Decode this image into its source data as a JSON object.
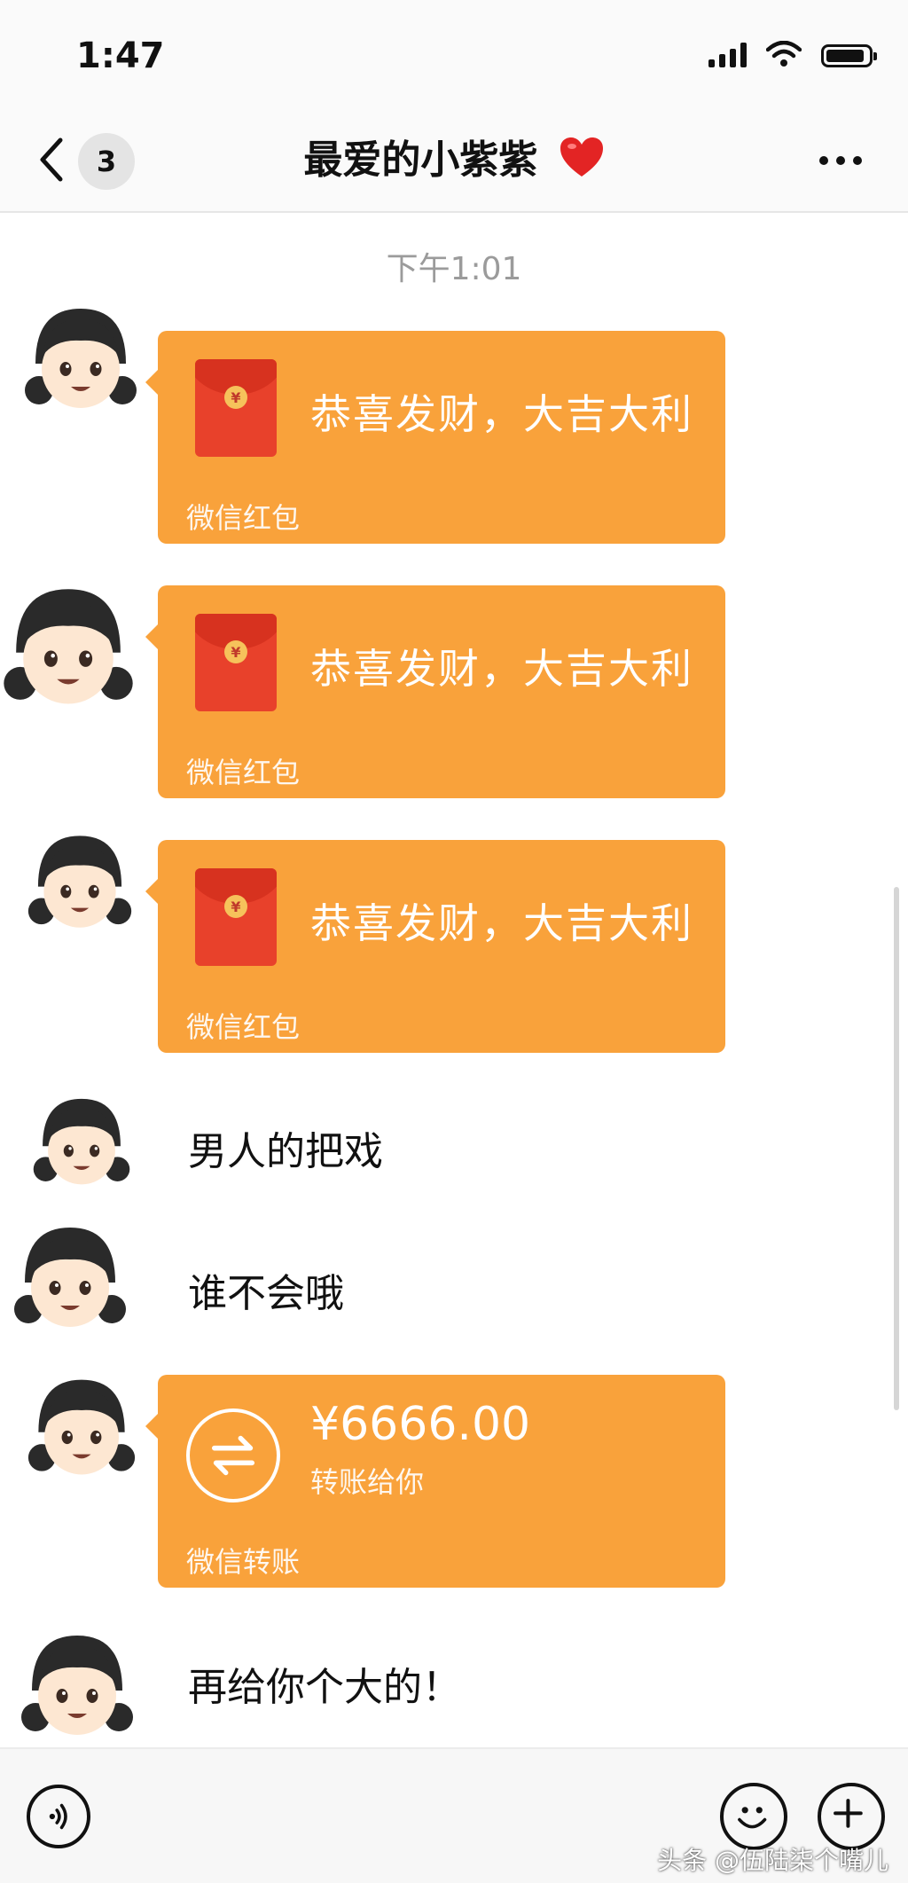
{
  "status_bar": {
    "time": "1:47",
    "icons": [
      "signal-icon",
      "wifi-icon",
      "battery-icon"
    ]
  },
  "header": {
    "back_icon": "chevron-left-icon",
    "unread_count": "3",
    "title": "最爱的小紫紫",
    "title_emoji": "red-heart-icon",
    "more_icon": "more-dots-icon"
  },
  "chat": {
    "timestamp": "下午1:01",
    "red_packets": [
      {
        "title": "恭喜发财，大吉大利",
        "footer": "微信红包"
      },
      {
        "title": "恭喜发财，大吉大利",
        "footer": "微信红包"
      },
      {
        "title": "恭喜发财，大吉大利",
        "footer": "微信红包"
      }
    ],
    "text_messages": [
      {
        "text": "男人的把戏"
      },
      {
        "text": "谁不会哦"
      },
      {
        "text": "再给你个大的！"
      }
    ],
    "transfer": {
      "amount": "¥6666.00",
      "note": "转账给你",
      "footer": "微信转账"
    }
  },
  "input_bar": {
    "voice_icon": "voice-icon",
    "emoji_icon": "emoji-icon",
    "plus_icon": "plus-icon"
  },
  "watermark": "头条 @伍陆柒个嘴儿",
  "colors": {
    "card_orange": "#f9a23b",
    "envelope_red": "#e8412b",
    "timestamp_gray": "#9b9b9b"
  }
}
